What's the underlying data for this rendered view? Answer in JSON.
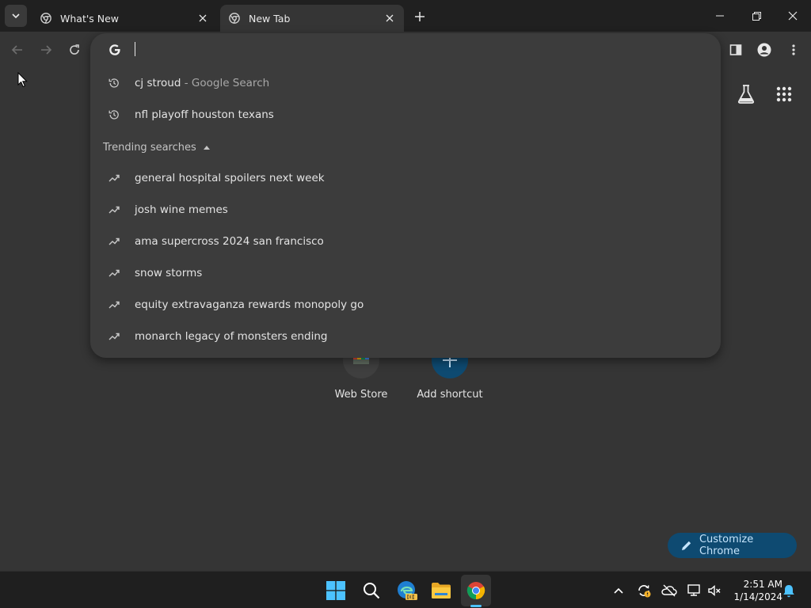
{
  "tabs": [
    {
      "title": "What's New",
      "active": false
    },
    {
      "title": "New Tab",
      "active": true
    }
  ],
  "omnibox": {
    "input_value": "",
    "history": [
      {
        "query": "cj stroud",
        "suffix": " - Google Search"
      },
      {
        "query": "nfl playoff houston texans",
        "suffix": ""
      }
    ],
    "trending_header": "Trending searches",
    "trending": [
      "general hospital spoilers next week",
      "josh wine memes",
      "ama supercross 2024 san francisco",
      "snow storms",
      "equity extravaganza rewards monopoly go",
      "monarch legacy of monsters ending"
    ]
  },
  "shortcuts": [
    {
      "label": "Web Store",
      "icon": "web-store-icon"
    },
    {
      "label": "Add shortcut",
      "icon": "plus-icon"
    }
  ],
  "customize_label": "Customize Chrome",
  "clock": {
    "time": "2:51 AM",
    "date": "1/14/2024"
  },
  "colors": {
    "tabstrip": "#202020",
    "page_background": "#353535",
    "dropdown": "#3c3c3c",
    "customize_button": "#0e4a71",
    "taskbar": "#1f1f1f",
    "accent": "#4cc2ff"
  }
}
